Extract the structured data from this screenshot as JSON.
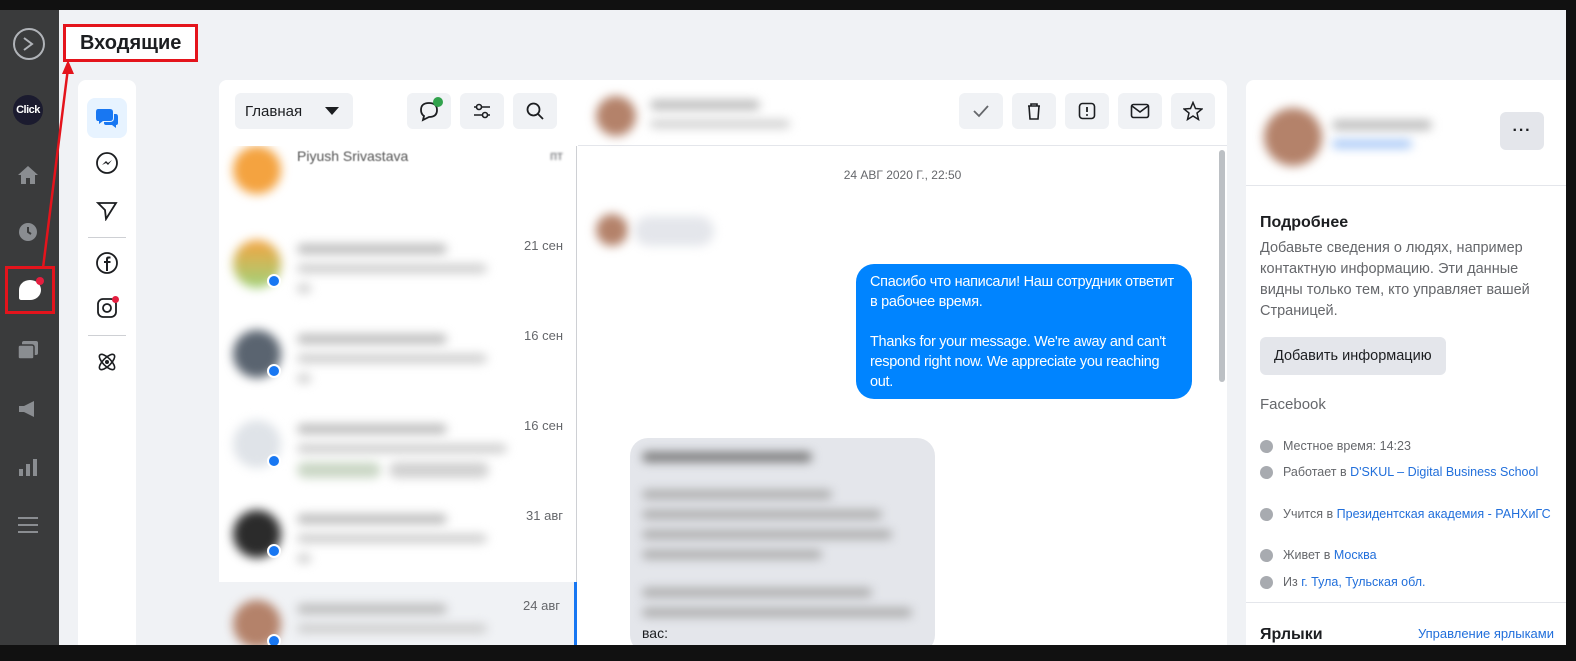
{
  "header": {
    "title": "Входящие"
  },
  "rail": {
    "click_label": "Click"
  },
  "list": {
    "dropdown_label": "Главная",
    "top_partial_name": "Piyush Srivastava",
    "top_partial_date": "пт",
    "conversations": [
      {
        "date": "21 сен"
      },
      {
        "date": "16 сен"
      },
      {
        "date": "16 сен"
      },
      {
        "date": "31 авг"
      },
      {
        "date": "24 авг"
      }
    ]
  },
  "thread": {
    "date_divider": "24 АВГ 2020 Г., 22:50",
    "auto_reply_ru": "Спасибо что написали! Наш сотрудник ответит в рабочее время.",
    "auto_reply_en": "Thanks for your message. We're away and can't respond right now. We appreciate you reaching out.",
    "incoming_last_line": "вас:"
  },
  "info": {
    "details_title": "Подробнее",
    "details_desc": "Добавьте сведения о людях, например контактную информацию. Эти данные видны только тем, кто управляет вашей Страницей.",
    "add_info_button": "Добавить информацию",
    "source_label": "Facebook",
    "local_time": "Местное время: 14:23",
    "works_prefix": "Работает в ",
    "works_link": "D'SKUL – Digital Business School",
    "studies_prefix": "Учится в ",
    "studies_link": "Президентская академия - РАНХиГС",
    "lives_prefix": "Живет в ",
    "lives_link": "Москва",
    "from_prefix": "Из ",
    "from_link": "г. Тула, Тульская обл.",
    "labels_title": "Ярлыки",
    "labels_manage_link": "Управление ярлыками"
  },
  "colors": {
    "accent": "#1877f2",
    "bubble": "#0084ff",
    "highlight": "#e4141c",
    "rail": "#3a3b3c"
  }
}
